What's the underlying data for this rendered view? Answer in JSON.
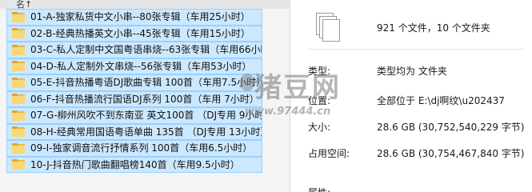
{
  "list": {
    "header_text": "名↑",
    "items": [
      {
        "label": "01-A-独家私货中文小串--80张专辑（车用25小时）"
      },
      {
        "label": "02-B-经典热播英文小串--45张专辑（车用15小时）"
      },
      {
        "label": "03-C-私人定制中文国粤语串烧--63张专辑（车用66小时）"
      },
      {
        "label": "04-D-私人定制外文串烧--56张专辑（车用53小时）"
      },
      {
        "label": "05-E-抖音热播粤语DJ歌曲专辑 100首（车用7.5小时）"
      },
      {
        "label": "06-F-抖音热播流行国语DJ系列 100首（车用 7小时）"
      },
      {
        "label": "07-G-柳州风吹不到东南亚 英文100首 （DJ专用 9小时）"
      },
      {
        "label": "08-H-经典常用国语粤语单曲 135首 （DJ专用 13小时）"
      },
      {
        "label": "09-I-独家调音流行抒情系列 100首（车用6.5小时）"
      },
      {
        "label": "10-J-抖音热门歌曲翻唱榜140首（车用9.5小时）"
      }
    ]
  },
  "props": {
    "summary": "921 个文件，10 个文件夹",
    "type_key": "类型:",
    "type_val": "类型均为 文件夹",
    "loc_key": "位置:",
    "loc_val": "全部位于 E:\\dj啊纹\\u202437",
    "size_key": "大小:",
    "size_val": "28.6 GB (30,752,540,229 字节)",
    "disk_key": "占用空间:",
    "disk_val": "28.6 GB (30,754,467,840 字节)",
    "last_key": "属性:"
  },
  "watermark": {
    "main": "猪豆网",
    "sub": "www.97444.cn"
  },
  "colors": {
    "selection_bg": "#cce8ff",
    "selection_border": "#99d1ff",
    "folder": "#f8d775"
  }
}
